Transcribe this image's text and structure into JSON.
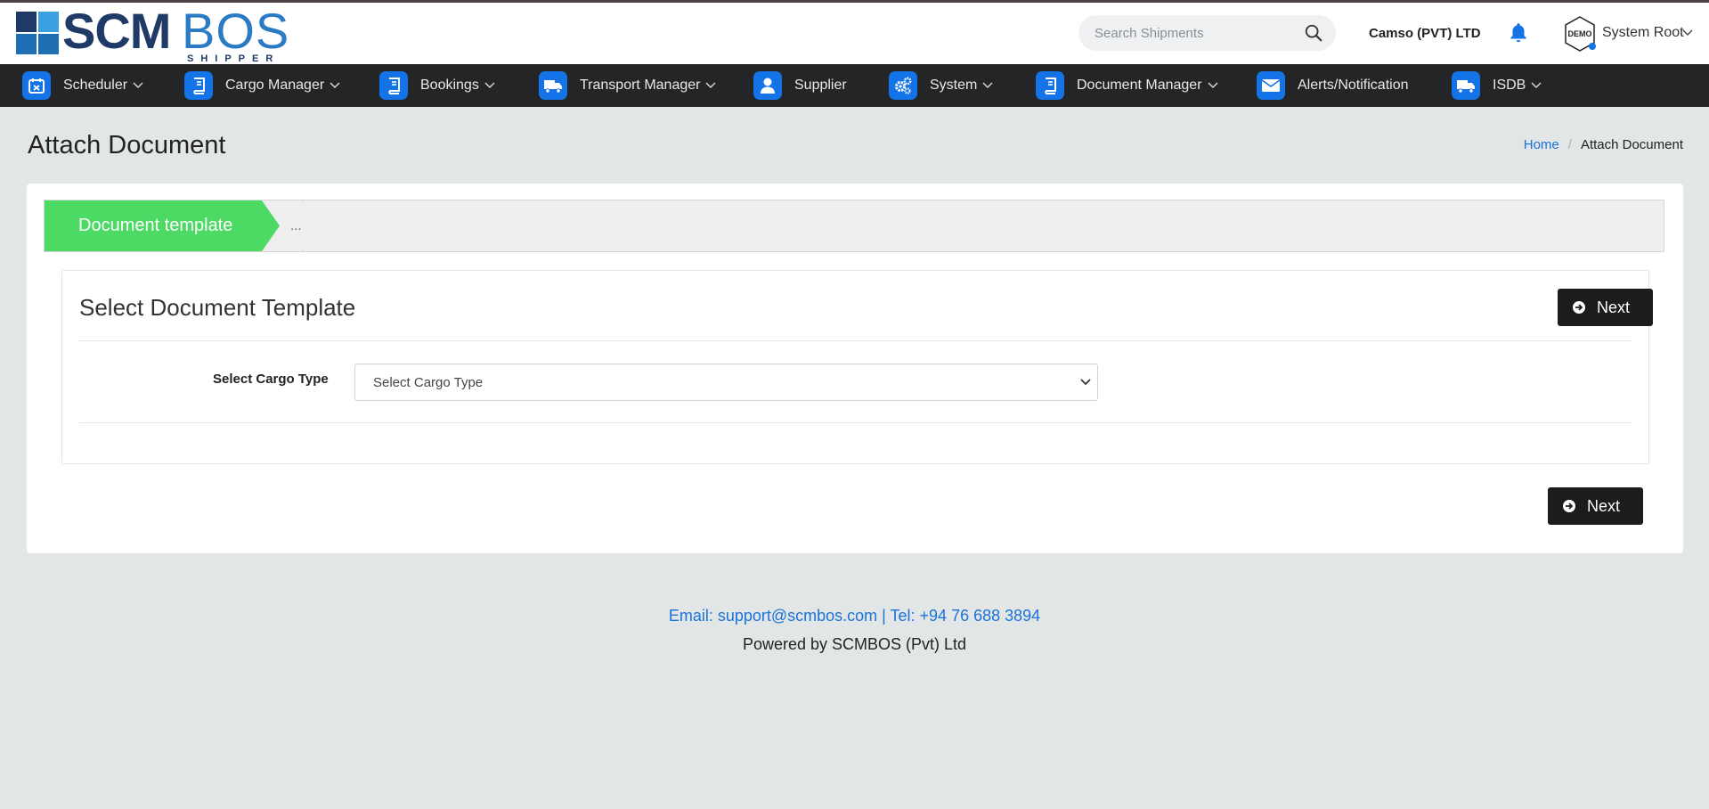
{
  "brand": {
    "primary": "SCM",
    "secondary": "BOS",
    "tagline": "SHIPPER",
    "colors": {
      "dark": "#1f3a66",
      "light": "#2a7ac4"
    }
  },
  "header": {
    "search_placeholder": "Search Shipments",
    "company": "Camso (PVT) LTD",
    "avatar_text": "DEMO",
    "user": "System Root"
  },
  "nav": {
    "items": [
      {
        "label": "Scheduler",
        "icon": "calendar-icon",
        "dropdown": true
      },
      {
        "label": "Cargo Manager",
        "icon": "book-icon",
        "dropdown": true
      },
      {
        "label": "Bookings",
        "icon": "book-icon",
        "dropdown": true
      },
      {
        "label": "Transport Manager",
        "icon": "truck-icon",
        "dropdown": true
      },
      {
        "label": "Supplier",
        "icon": "user-icon",
        "dropdown": false
      },
      {
        "label": "System",
        "icon": "gears-icon",
        "dropdown": true
      },
      {
        "label": "Document Manager",
        "icon": "book-icon",
        "dropdown": true
      },
      {
        "label": "Alerts/Notification",
        "icon": "envelope-icon",
        "dropdown": false
      },
      {
        "label": "ISDB",
        "icon": "truck-icon",
        "dropdown": true
      }
    ],
    "accent": "#1473e6"
  },
  "page": {
    "title": "Attach Document",
    "breadcrumb": {
      "home": "Home",
      "current": "Attach Document"
    }
  },
  "wizard": {
    "steps": [
      {
        "label": "Document template",
        "active": true
      },
      {
        "label": "...",
        "active": false
      }
    ],
    "active_color": "#4cd964"
  },
  "panel": {
    "title": "Select Document Template",
    "next_label": "Next",
    "cargo_label": "Select Cargo Type",
    "cargo_selected": "Select Cargo Type"
  },
  "footer": {
    "bottom_next_label": "Next",
    "contact": "Email: support@scmbos.com | Tel: +94 76 688 3894",
    "powered": "Powered by SCMBOS (Pvt) Ltd"
  }
}
